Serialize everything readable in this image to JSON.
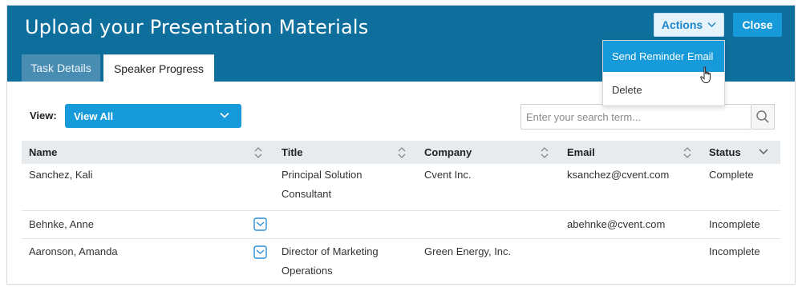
{
  "header": {
    "title": "Upload your Presentation Materials",
    "actions_label": "Actions",
    "close_label": "Close",
    "background_color": "#0f6f9c"
  },
  "tabs": [
    {
      "label": "Task Details",
      "active": false
    },
    {
      "label": "Speaker Progress",
      "active": true
    }
  ],
  "filter": {
    "view_label": "View:",
    "view_value": "View All",
    "search_placeholder": "Enter your search term..."
  },
  "table": {
    "columns": [
      "Name",
      "Title",
      "Company",
      "Email",
      "Status"
    ],
    "rows": [
      {
        "name": "Sanchez, Kali",
        "title_line1": "Principal Solution",
        "title_line2": "Consultant",
        "company": "Cvent Inc.",
        "email": "ksanchez@cvent.com",
        "status": "Complete",
        "has_mail_icon": false
      },
      {
        "name": "Behnke, Anne",
        "title_line1": "",
        "title_line2": "",
        "company": "",
        "email": "abehnke@cvent.com",
        "status": "Incomplete",
        "has_mail_icon": true
      },
      {
        "name": "Aaronson, Amanda",
        "title_line1": "Director of Marketing",
        "title_line2": "Operations",
        "company": "Green Energy, Inc.",
        "email": "",
        "status": "Incomplete",
        "has_mail_icon": true
      }
    ]
  },
  "actions_menu": {
    "items": [
      "Send Reminder Email",
      "Delete"
    ],
    "highlighted": "Send Reminder Email"
  },
  "colors": {
    "accent": "#179ad9",
    "header": "#0f6f9c",
    "table_header": "#e8ebee"
  },
  "icons": [
    "chevron-down-icon",
    "search-icon",
    "sort-icon",
    "mail-icon",
    "hand-cursor-icon"
  ]
}
